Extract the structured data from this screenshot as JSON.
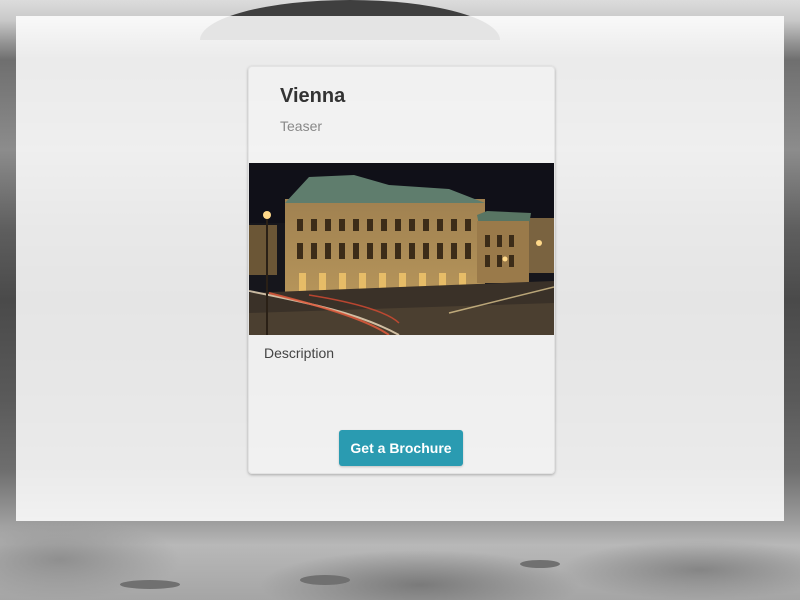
{
  "card": {
    "title": "Vienna",
    "teaser": "Teaser",
    "image_subject": "vienna-state-opera-at-night",
    "description": "Description",
    "button_label": "Get a Brochure"
  },
  "colors": {
    "button": "#2a9bb1",
    "title_text": "#333333",
    "teaser_text": "#888888"
  }
}
